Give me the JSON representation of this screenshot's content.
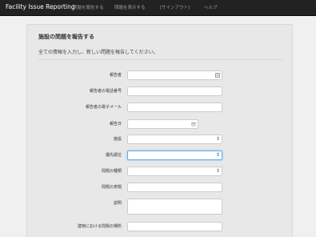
{
  "navbar": {
    "brand": "Facility Issue Reporting",
    "links": [
      "問題を報告する",
      "問題を表示する",
      "[サインアウト]",
      "ヘルプ"
    ]
  },
  "page": {
    "heading": "施設の問題を報告する",
    "intro": "全ての情報を入力し、新しい問題を報告してください。"
  },
  "form": {
    "reporter": {
      "label": "報告者",
      "value": ""
    },
    "phone": {
      "label": "報告者の電話番号",
      "value": ""
    },
    "email": {
      "label": "報告者の電子メール",
      "value": ""
    },
    "date": {
      "label": "報告日",
      "value": ""
    },
    "facility": {
      "label": "施設",
      "selected": ""
    },
    "priority": {
      "label": "優先順位",
      "selected": ""
    },
    "issue_type": {
      "label": "問題の種類",
      "selected": ""
    },
    "title": {
      "label": "問題の表題",
      "value": ""
    },
    "description": {
      "label": "説明",
      "value": ""
    },
    "location": {
      "label": "建物における問題の場所",
      "value": ""
    }
  },
  "icons": {
    "reporter_field": "contact-card-icon",
    "date_field": "calendar-icon",
    "select_caret": "up-down-caret-icon"
  },
  "colors": {
    "navbar_bg": "#222222",
    "focus_border": "#66afe9"
  }
}
